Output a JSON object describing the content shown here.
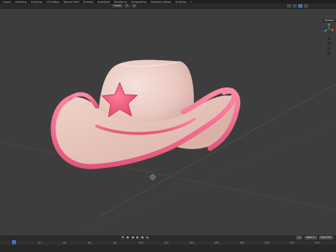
{
  "menu": {
    "items": [
      "Layout",
      "Modeling",
      "Sculpting",
      "UV Editing",
      "Texture Paint",
      "Shading",
      "Animation",
      "Rendering",
      "Compositing",
      "Geometry Nodes",
      "Scripting",
      "+"
    ]
  },
  "header": {
    "transform_orientation": "Global",
    "shading_modes": [
      "wireframe",
      "solid",
      "material-preview",
      "rendered"
    ],
    "active_shading": "material-preview"
  },
  "viewport": {
    "options_label": "Options",
    "colors": {
      "background": "#3d3d3d",
      "hat_body": "#e8c8c0",
      "hat_trim": "#ff6f8f",
      "star": "#f2607e",
      "x_axis": "#7a3a3a",
      "y_axis": "#5a6b3a"
    },
    "gizmo_icons": [
      "navigation-gizmo-icon",
      "zoom-icon",
      "pan-icon",
      "camera-icon",
      "perspective-icon"
    ]
  },
  "timeline": {
    "transport_icons": [
      "jump-start-icon",
      "prev-keyframe-icon",
      "play-reverse-icon",
      "play-icon",
      "next-keyframe-icon",
      "jump-end-icon"
    ],
    "start_label": "Start",
    "start": "1",
    "end_label": "End",
    "end": "250",
    "current_frame": "1",
    "ruler_ticks": [
      "0",
      "20",
      "40",
      "60",
      "80",
      "100",
      "120",
      "140",
      "160",
      "180",
      "200",
      "220",
      "240"
    ]
  }
}
